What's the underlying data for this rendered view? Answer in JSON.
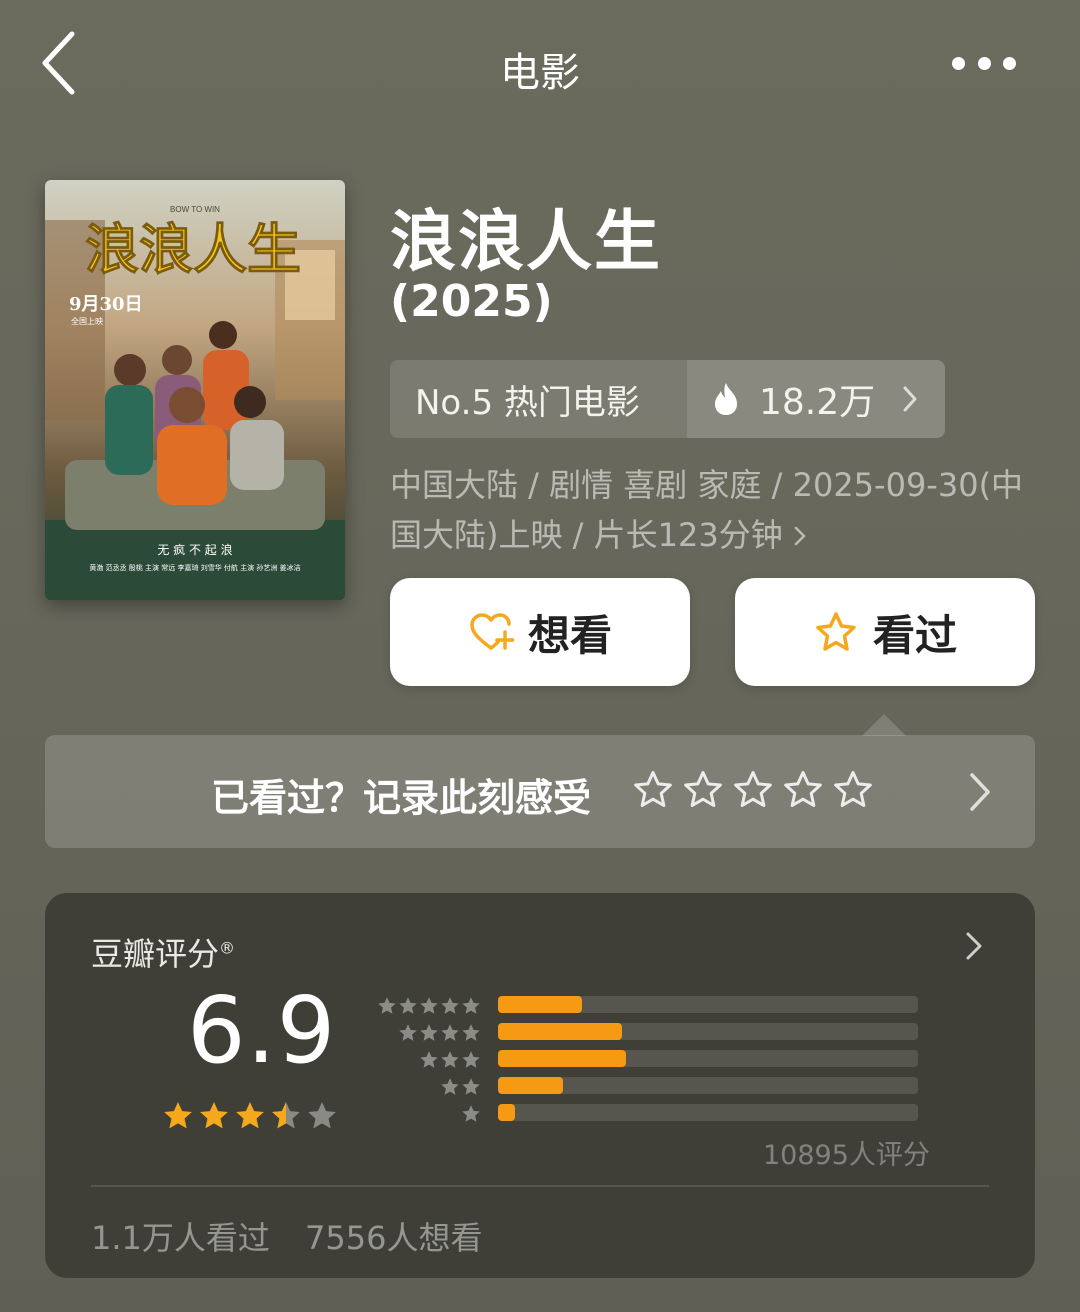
{
  "nav": {
    "title": "电影"
  },
  "movie": {
    "title": "浪浪人生",
    "year": "(2025)",
    "poster": {
      "title_text": "浪浪人生",
      "subtitle_en": "BOW TO WIN",
      "release_text": "9月30日",
      "release_sub": "全国上映",
      "tagline": "无 疯 不 起 浪",
      "credits": "黄渤 范丞丞 殷桃   主演 常远 李嘉琦 刘雪华 付航   主演 孙艺洲 姜冰洁"
    }
  },
  "rank": {
    "label": "No.5 热门电影",
    "heat": "18.2万",
    "icon": "flame-icon"
  },
  "meta": {
    "info": "中国大陆 / 剧情 喜剧 家庭 / 2025-09-30(中国大陆)上映 / 片长123分钟"
  },
  "actions": {
    "want_label": "想看",
    "seen_label": "看过",
    "accent": "#f5a81b"
  },
  "record": {
    "prompt": "已看过？记录此刻感受",
    "star_count": 5
  },
  "rating": {
    "header": "豆瓣评分",
    "registered_mark": "®",
    "score": "6.9",
    "stars_value": 3.5,
    "distribution_percent": [
      20,
      29.5,
      30.5,
      15.5,
      4
    ],
    "rating_count": "10895人评分",
    "seen_count": "1.1万人看过",
    "want_count": "7556人想看",
    "bar_color": "#f59a12"
  }
}
